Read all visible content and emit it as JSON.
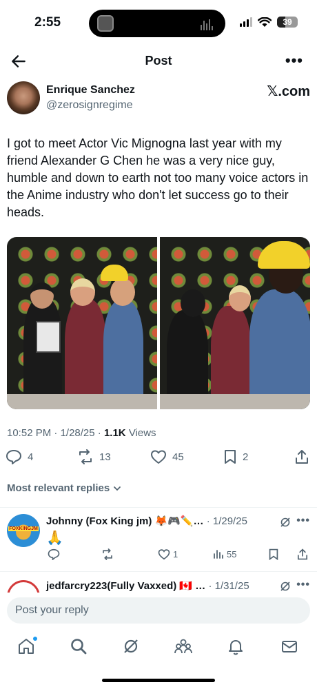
{
  "status_bar": {
    "time": "2:55",
    "battery": "39"
  },
  "header": {
    "title": "Post"
  },
  "author": {
    "name": "Enrique Sanchez",
    "handle": "@zerosignregime",
    "source": "𝕏.com"
  },
  "tweet": {
    "text": "I got to meet Actor Vic Mignogna last year with my friend Alexander G Chen he was a very nice guy, humble and down to earth not too many voice actors in the Anime industry who don't let success go to their heads.",
    "time": "10:52 PM",
    "date": "1/28/25",
    "views_count": "1.1K",
    "views_label": "Views"
  },
  "actions": {
    "replies": "4",
    "reposts": "13",
    "likes": "45",
    "bookmarks": "2"
  },
  "replies_filter": {
    "label": "Most relevant replies"
  },
  "replies": [
    {
      "name": "Johnny (Fox King jm) 🦊🎮✏️…",
      "date": "· 1/29/25",
      "text": "🙏",
      "likes": "1",
      "views": "55",
      "avatar_text": "FOXKINGJM"
    },
    {
      "name": "jedfarcry223(Fully Vaxxed) 🇨🇦 …",
      "date": "· 1/31/25"
    }
  ],
  "composer": {
    "placeholder": "Post your reply"
  },
  "colors": {
    "accent": "#1d9bf0",
    "text": "#0f1419",
    "muted": "#536471"
  }
}
